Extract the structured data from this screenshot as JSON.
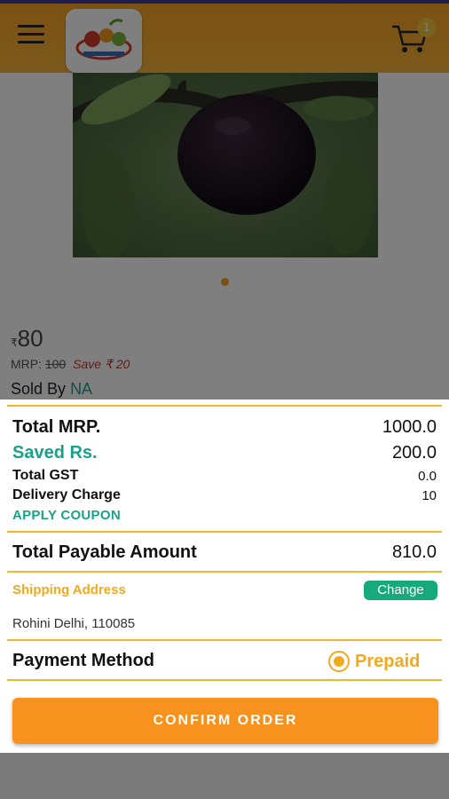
{
  "header": {
    "cart_count": "1"
  },
  "product": {
    "price_symbol": "₹",
    "price": "80",
    "mrp_label": "MRP:",
    "mrp_value": "100",
    "save_text": "Save ₹ 20",
    "sold_by_label": "Sold By",
    "sold_by_value": "NA"
  },
  "summary": {
    "total_mrp_label": "Total MRP.",
    "total_mrp_value": "1000.0",
    "saved_label": "Saved Rs.",
    "saved_value": "200.0",
    "gst_label": "Total GST",
    "gst_value": "0.0",
    "delivery_label": "Delivery Charge",
    "delivery_value": "10",
    "coupon_label": "APPLY COUPON",
    "payable_label": "Total Payable Amount",
    "payable_value": "810.0",
    "shipping_label": "Shipping Address",
    "change_label": "Change",
    "address": "Rohini Delhi, 110085",
    "payment_label": "Payment Method",
    "payment_value": "Prepaid",
    "confirm_label": "CONFIRM ORDER"
  },
  "colors": {
    "accent_orange": "#f7921e",
    "accent_teal": "#1aa18a",
    "divider_yellow": "#f3b529"
  }
}
